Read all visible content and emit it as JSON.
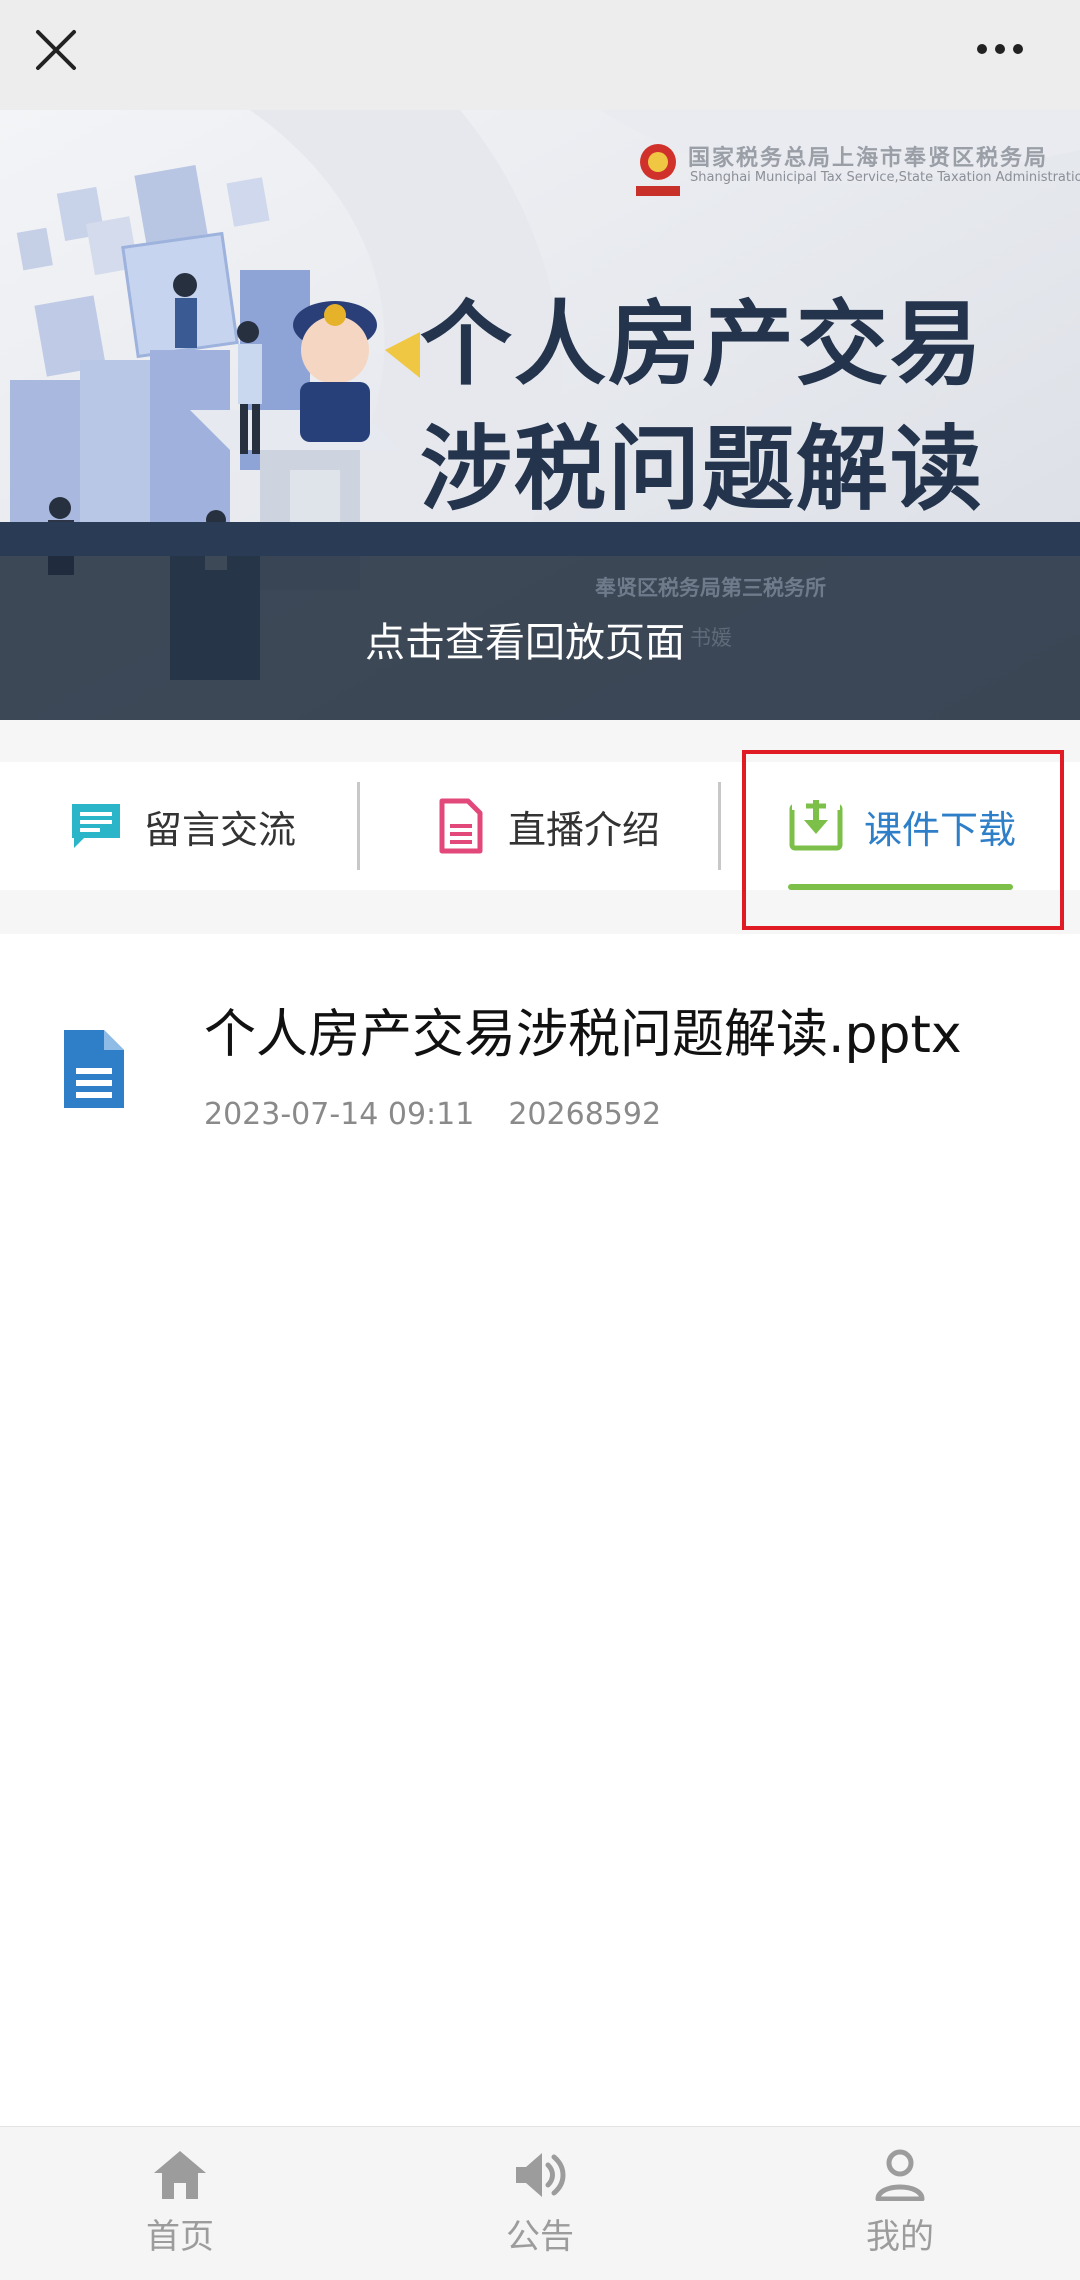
{
  "topbar": {
    "close_icon": "close-icon",
    "more_icon": "more-dots-icon"
  },
  "banner": {
    "org_name": "国家税务总局上海市奉贤区税务局",
    "org_en": "Shanghai Municipal Tax Service,State Taxation Administration",
    "title_line1": "个人房产交易",
    "title_line2": "涉税问题解读",
    "office": "奉贤区税务局第三税务所",
    "speaker": "书媛",
    "replay_label": "点击查看回放页面"
  },
  "tabs": [
    {
      "label": "留言交流",
      "icon": "chat-icon",
      "color": "#2bb5c8"
    },
    {
      "label": "直播介绍",
      "icon": "document-icon",
      "color": "#e2487a"
    },
    {
      "label": "课件下载",
      "icon": "download-icon",
      "color": "#7cc04a",
      "active": true
    }
  ],
  "file": {
    "name": "个人房产交易涉税问题解读.pptx",
    "date": "2023-07-14 09:11",
    "size": "20268592",
    "icon": "file-icon",
    "icon_color": "#2f7fc8"
  },
  "nav": [
    {
      "label": "首页",
      "icon": "home-icon"
    },
    {
      "label": "公告",
      "icon": "speaker-icon"
    },
    {
      "label": "我的",
      "icon": "user-icon"
    }
  ],
  "colors": {
    "accent": "#2f7fc8",
    "active_underline": "#7cc04a",
    "highlight_box": "#e01b24"
  }
}
